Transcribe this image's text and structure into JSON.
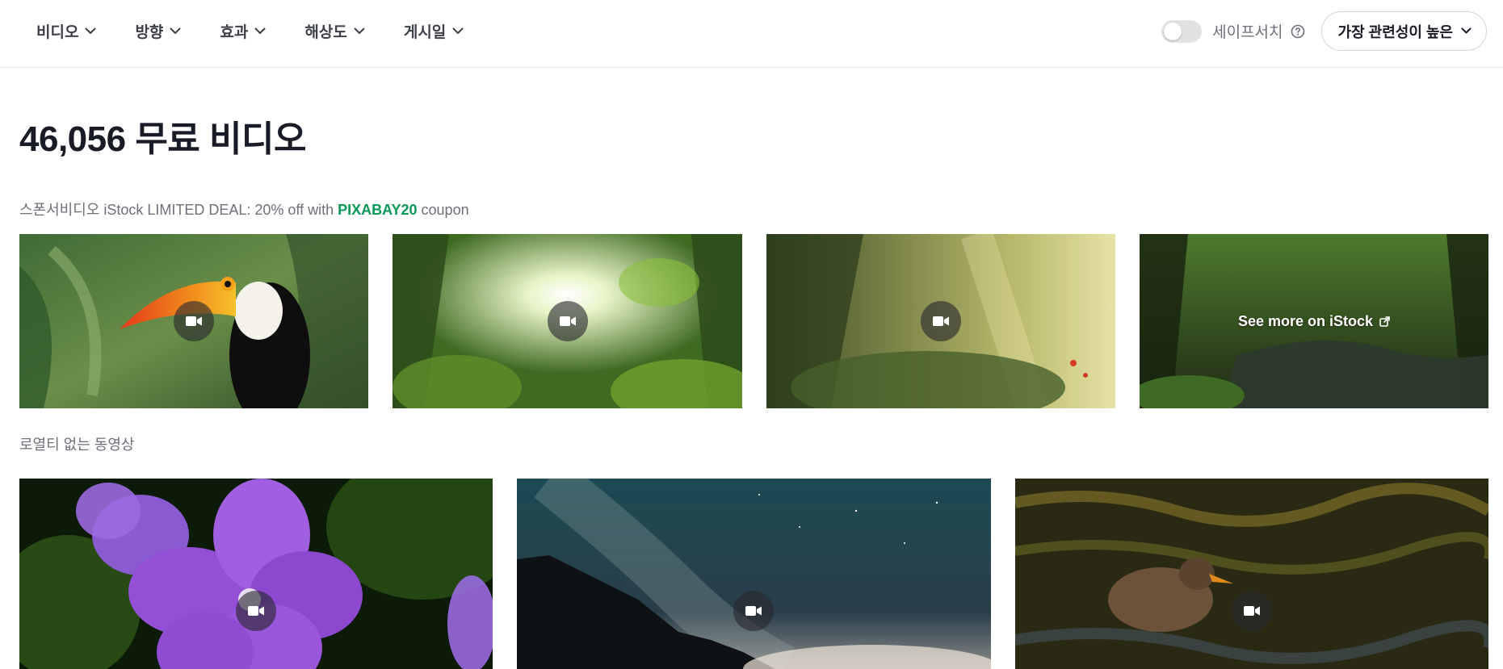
{
  "filters": [
    {
      "label": "비디오"
    },
    {
      "label": "방향"
    },
    {
      "label": "효과"
    },
    {
      "label": "해상도"
    },
    {
      "label": "게시일"
    }
  ],
  "safesearch": {
    "label": "세이프서치",
    "enabled": false
  },
  "sort": {
    "label": "가장 관련성이 높은"
  },
  "title": {
    "count": "46,056",
    "text": "무료 비디오"
  },
  "sponsor": {
    "prefix": "스폰서비디오 iStock LIMITED DEAL: 20% off with ",
    "code": "PIXABAY20",
    "suffix": " coupon"
  },
  "sponsored_tiles": [
    {
      "subject": "toucan"
    },
    {
      "subject": "sunlit jungle"
    },
    {
      "subject": "misty forest"
    },
    {
      "subject": "forest stream",
      "overlay": "See more on iStock"
    }
  ],
  "section_label": "로열티 없는 동영상",
  "video_tiles": [
    {
      "subject": "purple flower"
    },
    {
      "subject": "milky way over mountains"
    },
    {
      "subject": "duck on water"
    }
  ],
  "colors": {
    "accent_green": "#0a9a57",
    "text": "#191b26",
    "muted": "#6e7079"
  },
  "icons": [
    "chevron-down-icon",
    "help-icon",
    "video-camera-icon",
    "external-link-icon"
  ]
}
